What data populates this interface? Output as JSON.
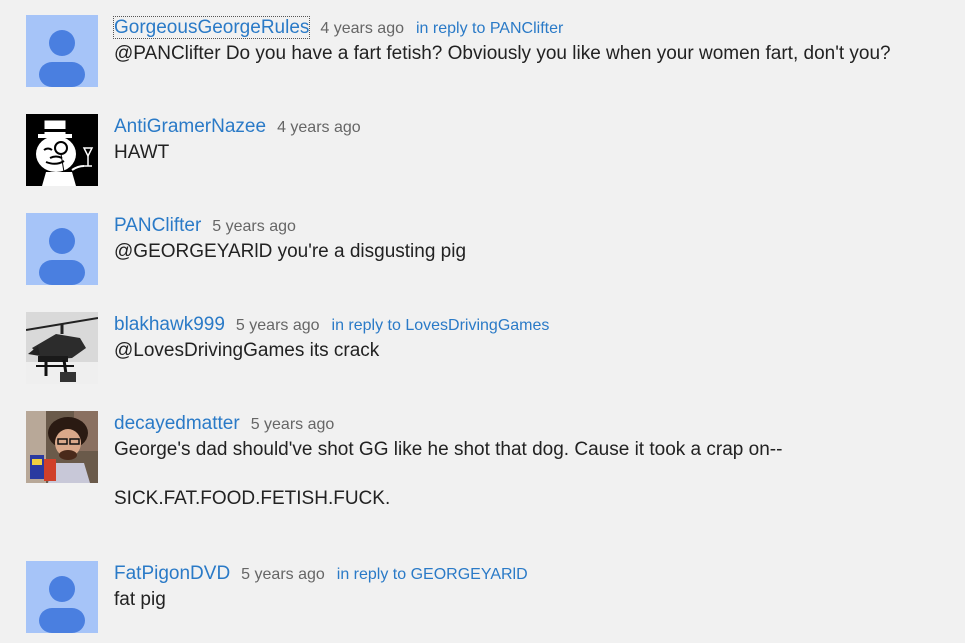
{
  "comments": [
    {
      "author": "GorgeousGeorgeRules",
      "time": "4 years ago",
      "reply_to": "in reply to PANClifter",
      "text": "@PANClifter Do you have a fart fetish?  Obviously you like when your women fart, don't you?",
      "avatar": "default-avatar"
    },
    {
      "author": "AntiGramerNazee",
      "time": "4 years ago",
      "reply_to": "",
      "text": "HAWT",
      "avatar": "top-hat-monocle-avatar"
    },
    {
      "author": "PANClifter",
      "time": "5 years ago",
      "reply_to": "",
      "text": "@GEORGEYARlD you're a disgusting pig",
      "avatar": "default-avatar"
    },
    {
      "author": "blakhawk999",
      "time": "5 years ago",
      "reply_to": "in reply to LovesDrivingGames",
      "text": "@LovesDrivingGames its crack",
      "avatar": "helicopter-avatar"
    },
    {
      "author": "decayedmatter",
      "time": "5 years ago",
      "reply_to": "",
      "text": "George's dad should've shot GG like he shot that dog. Cause it took a crap on--",
      "text2": "SICK.FAT.FOOD.FETISH.FUCK.",
      "avatar": "photo-avatar"
    },
    {
      "author": "FatPigonDVD",
      "time": "5 years ago",
      "reply_to": "in reply to GEORGEYARlD",
      "text": "fat pig",
      "avatar": "default-avatar"
    }
  ],
  "colors": {
    "link": "#2a7ac7",
    "default_avatar_bg": "#a6c4f8",
    "default_avatar_fg": "#4a7fe0"
  }
}
